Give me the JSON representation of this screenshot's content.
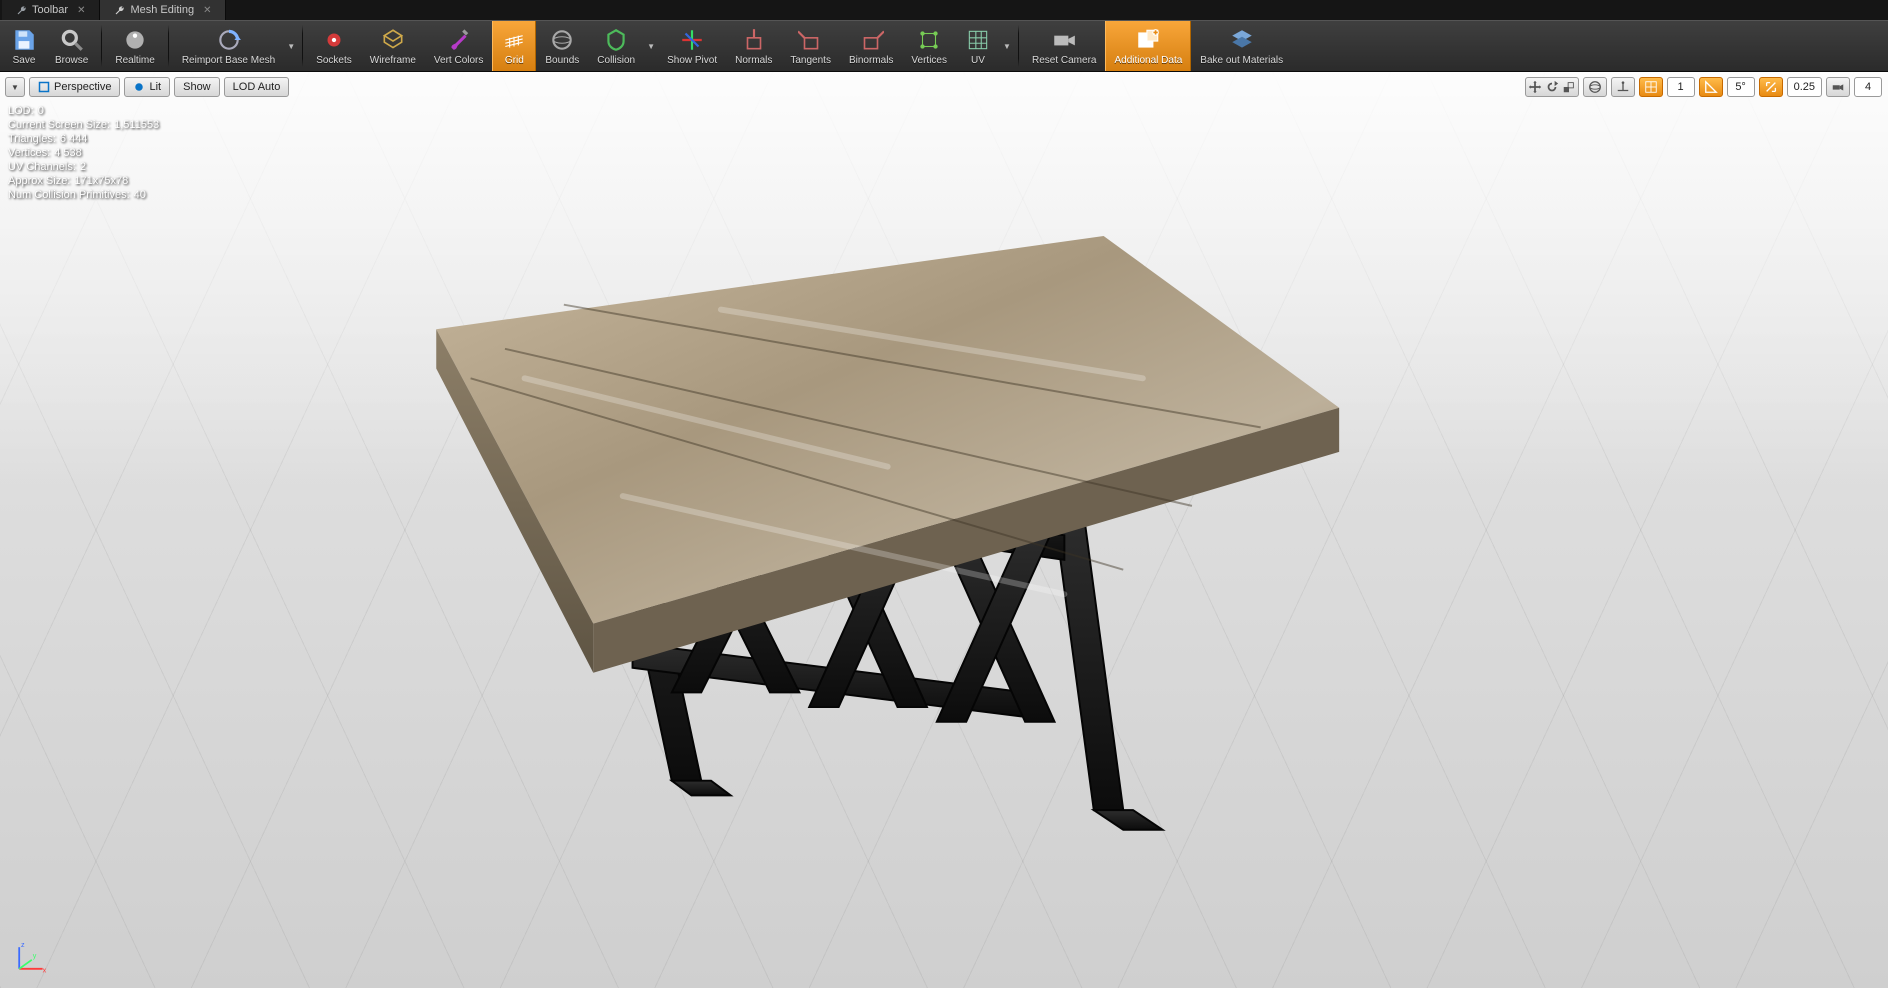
{
  "tabs": [
    {
      "label": "Toolbar",
      "active": false
    },
    {
      "label": "Mesh Editing",
      "active": true
    }
  ],
  "toolbar": {
    "save": "Save",
    "browse": "Browse",
    "realtime": "Realtime",
    "reimport": "Reimport Base Mesh",
    "sockets": "Sockets",
    "wireframe": "Wireframe",
    "vertcolors": "Vert Colors",
    "grid": "Grid",
    "bounds": "Bounds",
    "collision": "Collision",
    "showpivot": "Show Pivot",
    "normals": "Normals",
    "tangents": "Tangents",
    "binormals": "Binormals",
    "vertices": "Vertices",
    "uv": "UV",
    "resetcamera": "Reset Camera",
    "additionaldata": "Additional Data",
    "bakeout": "Bake out Materials"
  },
  "viewport": {
    "perspective": "Perspective",
    "lit": "Lit",
    "show": "Show",
    "lodauto": "LOD Auto"
  },
  "stats": {
    "lod_k": "LOD:",
    "lod_v": "0",
    "css_k": "Current Screen Size:",
    "css_v": "1,511553",
    "tri_k": "Triangles:",
    "tri_v": "6 444",
    "vtx_k": "Vertices:",
    "vtx_v": "4 538",
    "uvc_k": "UV Channels:",
    "uvc_v": "2",
    "apx_k": "Approx Size:",
    "apx_v": "171x75x78",
    "col_k": "Num Collision Primitives:",
    "col_v": "40"
  },
  "snap": {
    "grid_val": "1",
    "angle_val": "5°",
    "scale_val": "0.25",
    "cam_val": "4"
  },
  "axis": {
    "x": "x",
    "y": "y",
    "z": "z"
  }
}
